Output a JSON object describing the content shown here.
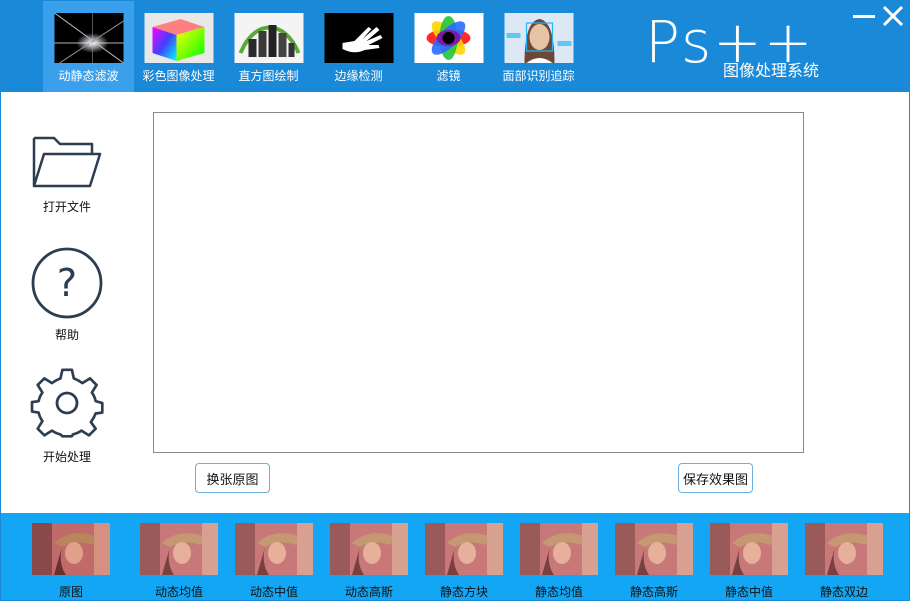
{
  "header": {
    "modules": [
      {
        "label": "动静态滤波",
        "icon": "light-burst-icon",
        "active": true
      },
      {
        "label": "彩色图像处理",
        "icon": "color-cube-icon",
        "active": false
      },
      {
        "label": "直方图绘制",
        "icon": "3d-histogram-icon",
        "active": false
      },
      {
        "label": "边缘检测",
        "icon": "hand-edge-icon",
        "active": false
      },
      {
        "label": "滤镜",
        "icon": "color-flower-icon",
        "active": false
      },
      {
        "label": "面部识别追踪",
        "icon": "face-tracking-icon",
        "active": false
      }
    ],
    "brand_title": "Ps++",
    "brand_subtitle": "图像处理系统",
    "accent": "#1a8ad8"
  },
  "sidebar": {
    "open_file": "打开文件",
    "help": "帮助",
    "start": "开始处理"
  },
  "main": {
    "swap_button": "换张原图",
    "save_button": "保存效果图"
  },
  "samples": {
    "items": [
      {
        "label": "原图"
      },
      {
        "label": "动态均值"
      },
      {
        "label": "动态中值"
      },
      {
        "label": "动态高斯"
      },
      {
        "label": "静态方块"
      },
      {
        "label": "静态均值"
      },
      {
        "label": "静态高斯"
      },
      {
        "label": "静态中值"
      },
      {
        "label": "静态双边"
      }
    ],
    "strip_color": "#12a6f4"
  }
}
